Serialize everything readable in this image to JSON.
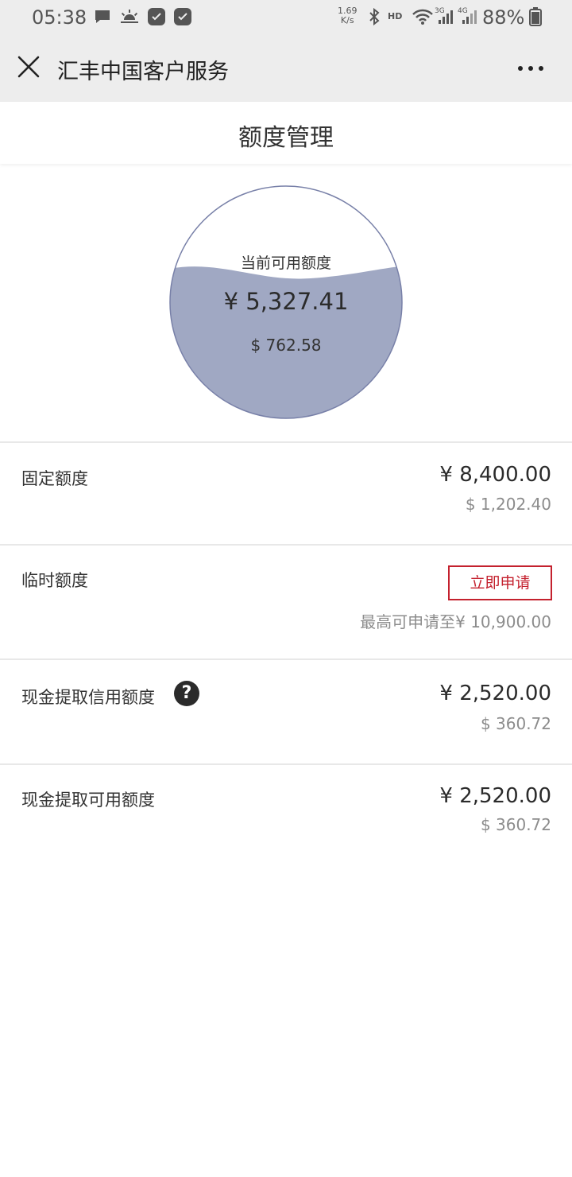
{
  "status_bar": {
    "time": "05:38",
    "net_speed_value": "1.69",
    "net_speed_unit": "K/s",
    "hd": "HD",
    "network_3g": "3G",
    "network_4g": "4G",
    "battery": "88%",
    "icons": [
      "message-icon",
      "weather-icon",
      "app-badge-icon",
      "app-badge-icon",
      "bluetooth-icon",
      "wifi-icon",
      "signal-icon",
      "battery-icon"
    ]
  },
  "title_bar": {
    "title": "汇丰中国客户服务",
    "close_icon": "close-icon",
    "more_icon": "more-icon"
  },
  "page": {
    "title": "额度管理"
  },
  "gauge": {
    "label": "当前可用额度",
    "cny": "¥ 5,327.41",
    "usd": "$ 762.58",
    "fill_ratio": 0.634,
    "fill_color": "#a0a8c3",
    "stroke_color": "#7880a8"
  },
  "rows": {
    "fixed": {
      "label": "固定额度",
      "cny": "¥ 8,400.00",
      "usd": "$ 1,202.40"
    },
    "temporary": {
      "label": "临时额度",
      "button": "立即申请",
      "note": "最高可申请至¥ 10,900.00"
    },
    "cash_credit": {
      "label": "现金提取信用额度",
      "help": "?",
      "cny": "¥ 2,520.00",
      "usd": "$ 360.72"
    },
    "cash_available": {
      "label": "现金提取可用额度",
      "cny": "¥ 2,520.00",
      "usd": "$ 360.72"
    }
  },
  "colors": {
    "accent": "#c4212e",
    "header_bg": "#ededed",
    "muted_text": "#8c8c8c"
  }
}
